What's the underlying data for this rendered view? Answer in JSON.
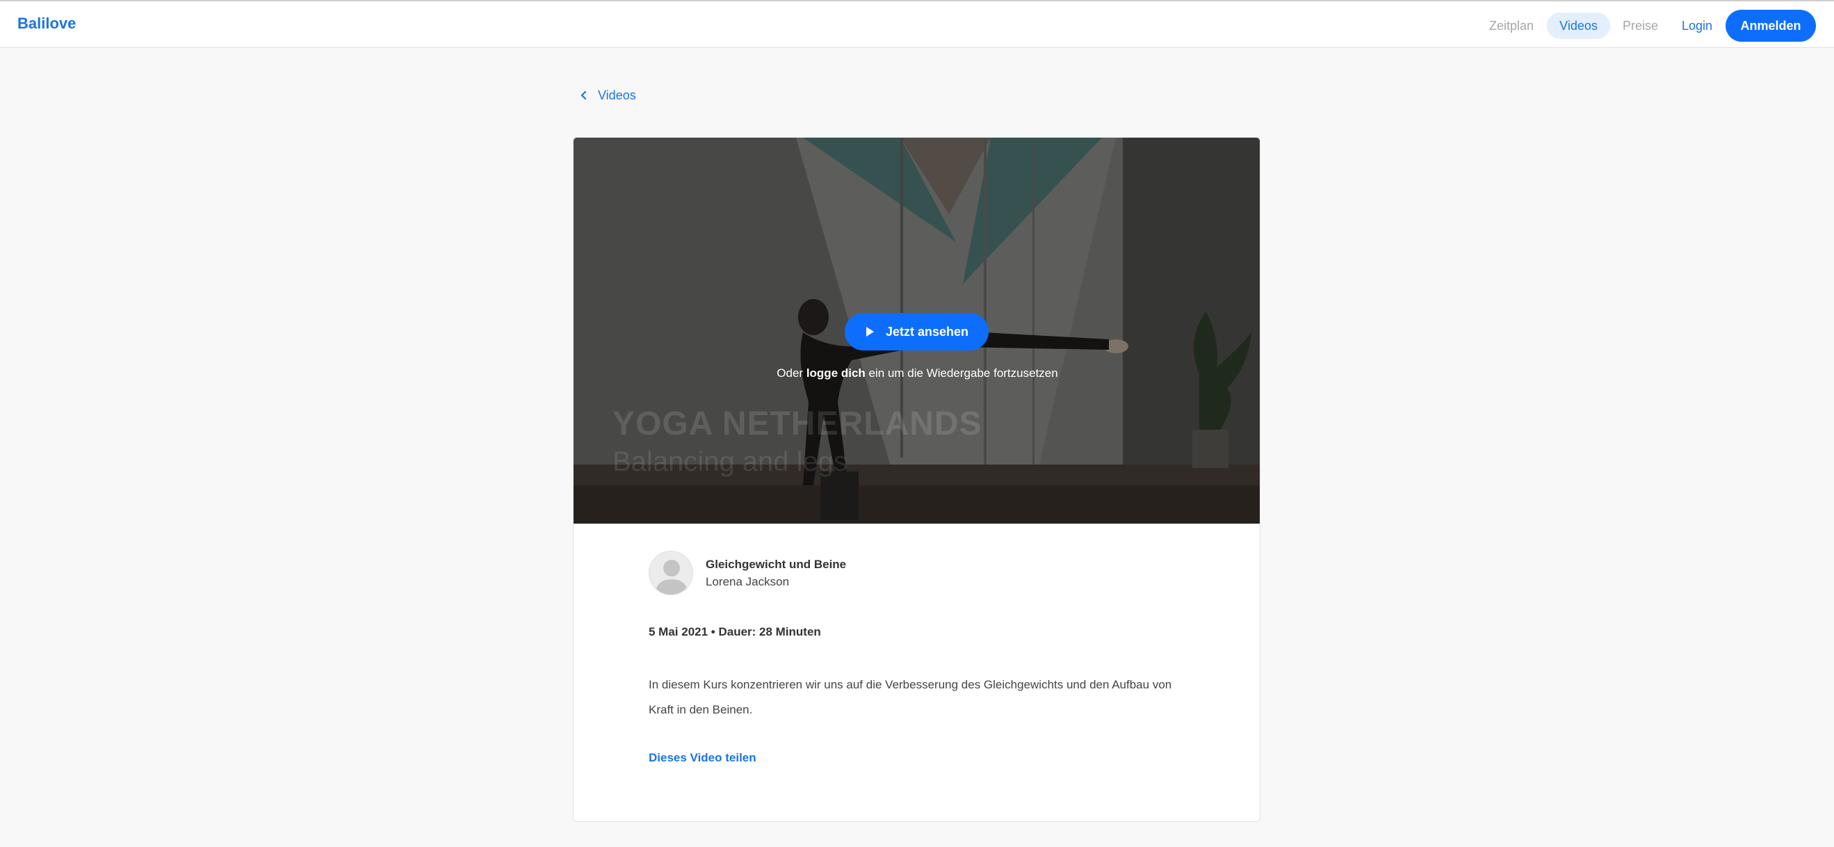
{
  "header": {
    "brand": "Balilove",
    "nav": {
      "zeitplan": "Zeitplan",
      "videos": "Videos",
      "preise": "Preise",
      "login": "Login"
    },
    "signup_label": "Anmelden"
  },
  "back_link": {
    "label": "Videos",
    "icon": "chevron-left-icon"
  },
  "video": {
    "watch_label": "Jetzt ansehen",
    "play_icon": "play-icon",
    "login_hint_prefix": "Oder",
    "login_hint_link": "logge dich",
    "login_hint_suffix": "ein um die Wiedergabe fortzusetzen",
    "watermark_title": "YOGA NETHERLANDS",
    "watermark_subtitle": "Balancing and legs"
  },
  "details": {
    "title": "Gleichgewicht und Beine",
    "teacher": "Lorena Jackson",
    "meta": "5 Mai 2021 • Dauer: 28 Minuten",
    "description": "In diesem Kurs konzentrieren wir uns auf die Verbesserung des Gleichgewichts und den Aufbau von Kraft in den Beinen.",
    "share_label": "Dieses Video teilen"
  },
  "colors": {
    "accent": "#0d6efd",
    "link": "#1a73e8",
    "nav_active_bg": "#e3effc"
  }
}
